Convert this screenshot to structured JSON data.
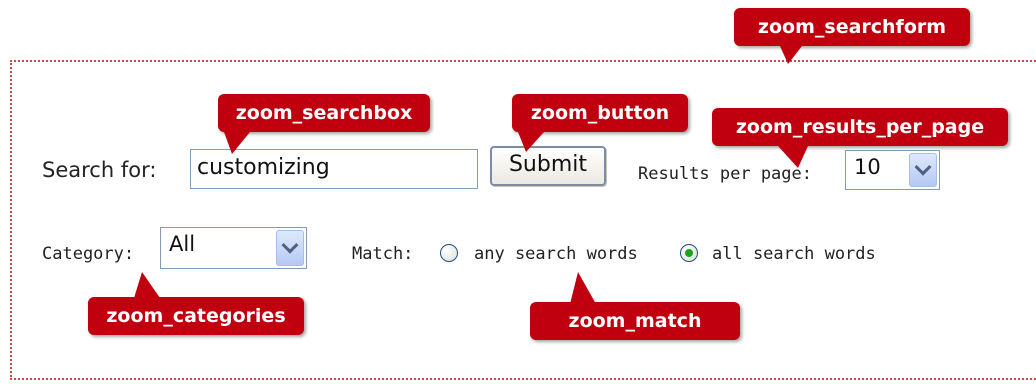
{
  "form": {
    "search_label": "Search for:",
    "search_value": "customizing",
    "submit_label": "Submit",
    "results_label": "Results per page:",
    "results_value": "10",
    "category_label": "Category:",
    "category_value": "All",
    "match_label": "Match:",
    "match_any_label": "any search words",
    "match_all_label": "all search words",
    "match_selected": "all"
  },
  "callouts": {
    "searchform": "zoom_searchform",
    "searchbox": "zoom_searchbox",
    "button": "zoom_button",
    "results_per_page": "zoom_results_per_page",
    "categories": "zoom_categories",
    "match": "zoom_match"
  },
  "colors": {
    "callout_bg": "#c0000f",
    "border_dotted": "#c84848",
    "radio_selected": "#21a121"
  }
}
